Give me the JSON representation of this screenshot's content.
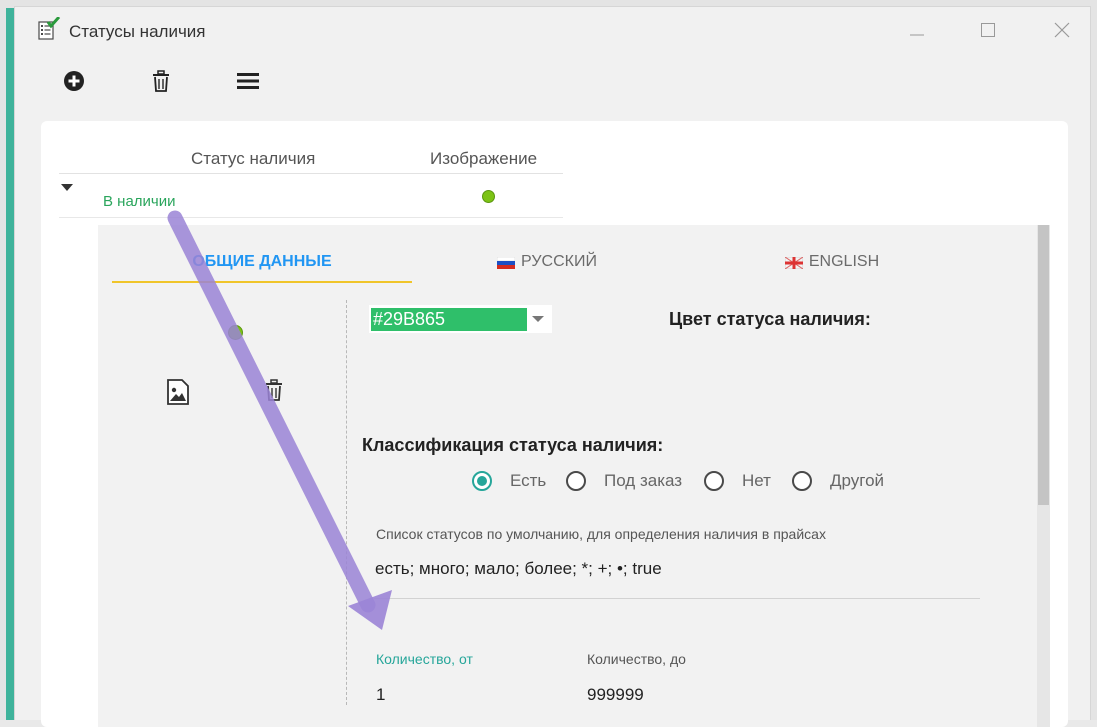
{
  "window": {
    "title": "Статусы наличия",
    "icon": "checklist-icon",
    "controls": [
      "minimize-icon",
      "maximize-icon",
      "close-icon"
    ]
  },
  "toolbar": {
    "buttons": [
      {
        "icon": "add-circle-icon"
      },
      {
        "icon": "trash-icon"
      },
      {
        "icon": "menu-icon"
      }
    ]
  },
  "grid": {
    "columns": [
      "Статус наличия",
      "Изображение"
    ],
    "rows": [
      {
        "name": "В наличии",
        "image_color": "#7cc315"
      }
    ]
  },
  "detail": {
    "tabs": [
      {
        "label": "ОБЩИЕ ДАННЫЕ",
        "active": true
      },
      {
        "label": "РУССКИЙ",
        "flag": "russia-flag-icon"
      },
      {
        "label": "ENGLISH",
        "flag": "uk-flag-icon"
      }
    ],
    "color": {
      "value": "#29B865",
      "label": "Цвет статуса наличия:"
    },
    "classification": {
      "title": "Классификация статуса наличия:",
      "options": [
        "Есть",
        "Под заказ",
        "Нет",
        "Другой"
      ],
      "selected": "Есть"
    },
    "default_list": {
      "label": "Список статусов по умолчанию, для определения наличия в прайсах",
      "value": "есть; много; мало; более; *; +; •; true"
    },
    "quantity": {
      "from_label": "Количество, от",
      "from_value": "1",
      "to_label": "Количество, до",
      "to_value": "999999"
    }
  },
  "colors": {
    "accent": "#3fb39b",
    "status_green": "#2aa55c",
    "tab_active": "#2196f3",
    "tab_underline": "#f0c52a",
    "annotation_arrow": "#9b84d6"
  }
}
